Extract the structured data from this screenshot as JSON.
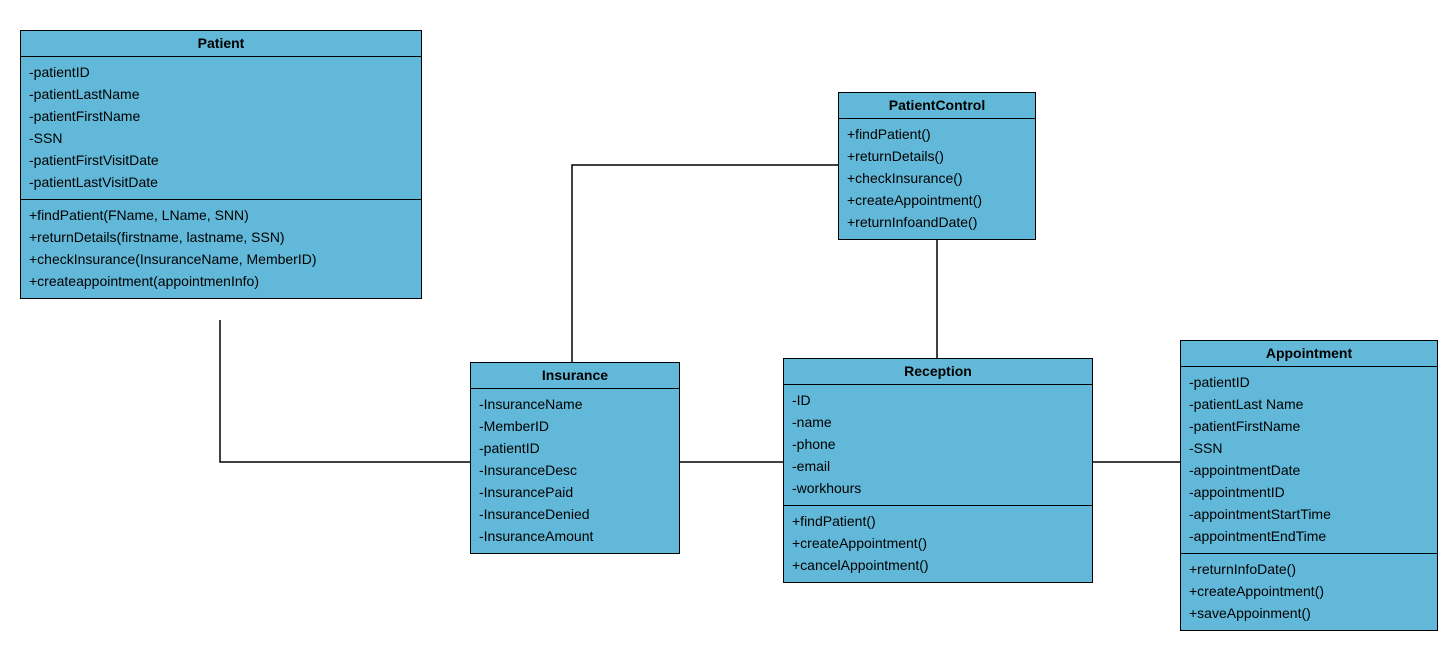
{
  "colors": {
    "fill": "#62B8D8",
    "stroke": "#000000"
  },
  "classes": {
    "patient": {
      "title": "Patient",
      "attrs": [
        "-patientID",
        "-patientLastName",
        "-patientFirstName",
        "-SSN",
        "-patientFirstVisitDate",
        "-patientLastVisitDate"
      ],
      "ops": [
        "+findPatient(FName, LName, SNN)",
        "+returnDetails(firstname, lastname, SSN)",
        "+checkInsurance(InsuranceName, MemberID)",
        "+createappointment(appointmenInfo)"
      ]
    },
    "patientControl": {
      "title": "PatientControl",
      "ops": [
        "+findPatient()",
        "+returnDetails()",
        "+checkInsurance()",
        "+createAppointment()",
        "+returnInfoandDate()"
      ]
    },
    "insurance": {
      "title": "Insurance",
      "attrs": [
        "-InsuranceName",
        "-MemberID",
        "-patientID",
        "-InsuranceDesc",
        "-InsurancePaid",
        "-InsuranceDenied",
        "-InsuranceAmount"
      ]
    },
    "reception": {
      "title": "Reception",
      "attrs": [
        "-ID",
        "-name",
        "-phone",
        "-email",
        "-workhours"
      ],
      "ops": [
        "+findPatient()",
        "+createAppointment()",
        "+cancelAppointment()"
      ]
    },
    "appointment": {
      "title": "Appointment",
      "attrs": [
        "-patientID",
        "-patientLast Name",
        "-patientFirstName",
        "-SSN",
        "-appointmentDate",
        "-appointmentID",
        "-appointmentStartTime",
        "-appointmentEndTime"
      ],
      "ops": [
        "+returnInfoDate()",
        "+createAppointment()",
        "+saveAppoinment()"
      ]
    }
  }
}
